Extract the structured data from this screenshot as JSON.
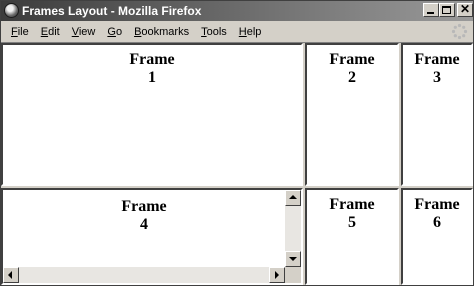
{
  "window": {
    "title": "Frames Layout - Mozilla Firefox",
    "icon": "firefox-icon",
    "controls": [
      "minimize-icon",
      "maximize-icon",
      "close-icon"
    ],
    "close_glyph": "✕"
  },
  "menubar": {
    "items": [
      {
        "label": "File"
      },
      {
        "label": "Edit"
      },
      {
        "label": "View"
      },
      {
        "label": "Go"
      },
      {
        "label": "Bookmarks"
      },
      {
        "label": "Tools"
      },
      {
        "label": "Help"
      }
    ],
    "throbber_icon": "throbber-icon"
  },
  "frames": [
    {
      "word": "Frame",
      "number": "1"
    },
    {
      "word": "Frame",
      "number": "2"
    },
    {
      "word": "Frame",
      "number": "3"
    },
    {
      "word": "Frame",
      "number": "4"
    },
    {
      "word": "Frame",
      "number": "5"
    },
    {
      "word": "Frame",
      "number": "6"
    }
  ],
  "colors": {
    "chrome": "#d4d0c8",
    "frame_background": "#ffffff",
    "title_gradient_start": "#3c3c3c",
    "title_gradient_end": "#9a9a9a"
  }
}
